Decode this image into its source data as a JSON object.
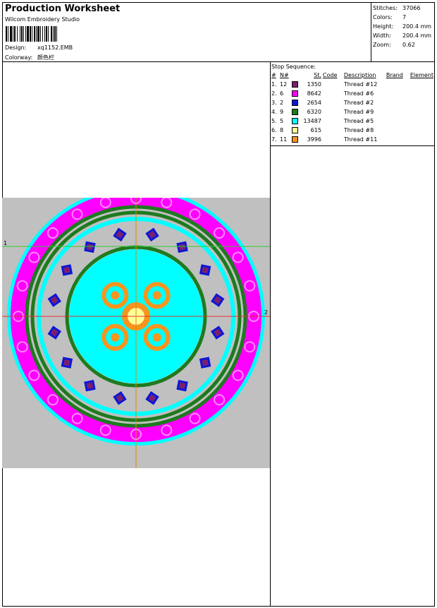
{
  "header": {
    "title": "Production Worksheet",
    "software": "Wilcom Embroidery Studio",
    "design_label": "Design:",
    "design_value": "xq1152.EMB",
    "colorway_label": "Colorway:",
    "colorway_value": "颜色栏"
  },
  "stats": [
    {
      "label": "Stitches:",
      "value": "37066"
    },
    {
      "label": "Colors:",
      "value": "7"
    },
    {
      "label": "Height:",
      "value": "200.4 mm"
    },
    {
      "label": "Width:",
      "value": "200.4 mm"
    },
    {
      "label": "Zoom:",
      "value": "0.62"
    }
  ],
  "stop_sequence": {
    "title": "Stop Sequence:",
    "columns": [
      "#",
      "N#",
      "",
      "St.",
      "Code",
      "Description",
      "Brand",
      "Element"
    ],
    "rows": [
      {
        "index": "1.",
        "n": "12",
        "color": "#7a1f6e",
        "stitches": "1350",
        "code": "",
        "description": "Thread #12",
        "brand": "",
        "element": ""
      },
      {
        "index": "2.",
        "n": "6",
        "color": "#ff00ff",
        "stitches": "8642",
        "code": "",
        "description": "Thread #6",
        "brand": "",
        "element": ""
      },
      {
        "index": "3.",
        "n": "2",
        "color": "#0b17d8",
        "stitches": "2654",
        "code": "",
        "description": "Thread #2",
        "brand": "",
        "element": ""
      },
      {
        "index": "4.",
        "n": "9",
        "color": "#1e7a1e",
        "stitches": "6320",
        "code": "",
        "description": "Thread #9",
        "brand": "",
        "element": ""
      },
      {
        "index": "5.",
        "n": "5",
        "color": "#00ffff",
        "stitches": "13487",
        "code": "",
        "description": "Thread #5",
        "brand": "",
        "element": ""
      },
      {
        "index": "6.",
        "n": "8",
        "color": "#ffff99",
        "stitches": "615",
        "code": "",
        "description": "Thread #8",
        "brand": "",
        "element": ""
      },
      {
        "index": "7.",
        "n": "11",
        "color": "#f7941d",
        "stitches": "3996",
        "code": "",
        "description": "Thread #11",
        "brand": "",
        "element": ""
      }
    ]
  },
  "preview": {
    "axis_label_left": "1",
    "axis_label_right": "2",
    "background_color": "#c0c0c0",
    "guide_green": "#2ecc2e",
    "guide_red": "#e03030",
    "guide_orange": "#d98c00"
  }
}
